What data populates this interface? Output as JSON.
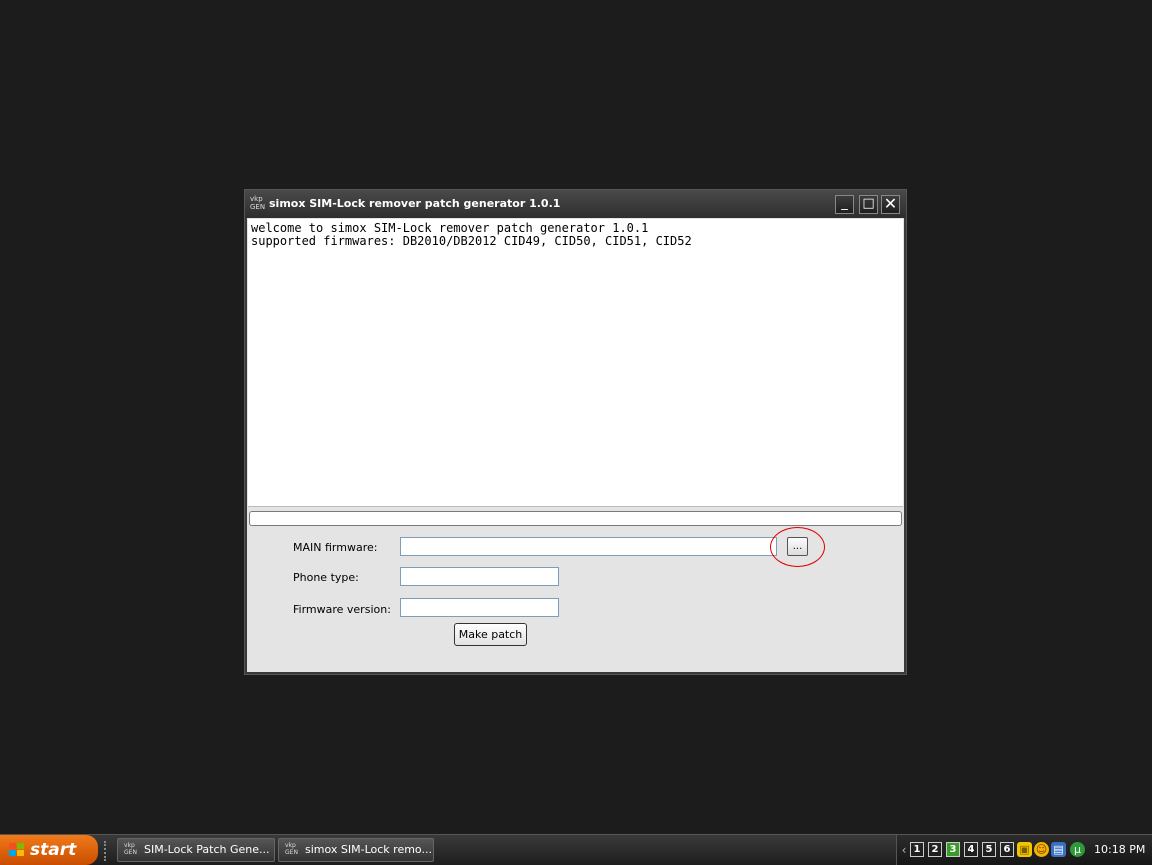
{
  "window": {
    "icon_text_top": "vkp",
    "icon_text_bottom": "GEN",
    "title": "simox SIM-Lock remover patch generator 1.0.1",
    "minimize_glyph": "_",
    "maximize_glyph": "□",
    "close_glyph": "✕"
  },
  "log": {
    "lines": [
      "welcome to simox SIM-Lock remover patch generator 1.0.1",
      "supported firmwares: DB2010/DB2012 CID49, CID50, CID51, CID52"
    ]
  },
  "form": {
    "main_firmware_label": "MAIN firmware:",
    "main_firmware_value": "",
    "browse_label": "...",
    "phone_type_label": "Phone type:",
    "phone_type_value": "",
    "firmware_version_label": "Firmware version:",
    "firmware_version_value": "",
    "make_patch_label": "Make patch"
  },
  "taskbar": {
    "start_label": "start",
    "tasks": [
      {
        "icon_top": "vkp",
        "icon_bottom": "GEN",
        "label": "SIM-Lock Patch Gene..."
      },
      {
        "icon_top": "vkp",
        "icon_bottom": "GEN",
        "label": "simox SIM-Lock remo..."
      }
    ],
    "desktops": [
      "1",
      "2",
      "3",
      "4",
      "5",
      "6"
    ],
    "active_desktop": "3",
    "tray_icons": [
      "package-icon",
      "smiley-icon",
      "network-icon",
      "utorrent-icon"
    ],
    "clock": "10:18 PM"
  },
  "colors": {
    "annotation_circle": "#e00000",
    "start_button": "#e06a12",
    "active_desktop": "#3a9a2a"
  }
}
